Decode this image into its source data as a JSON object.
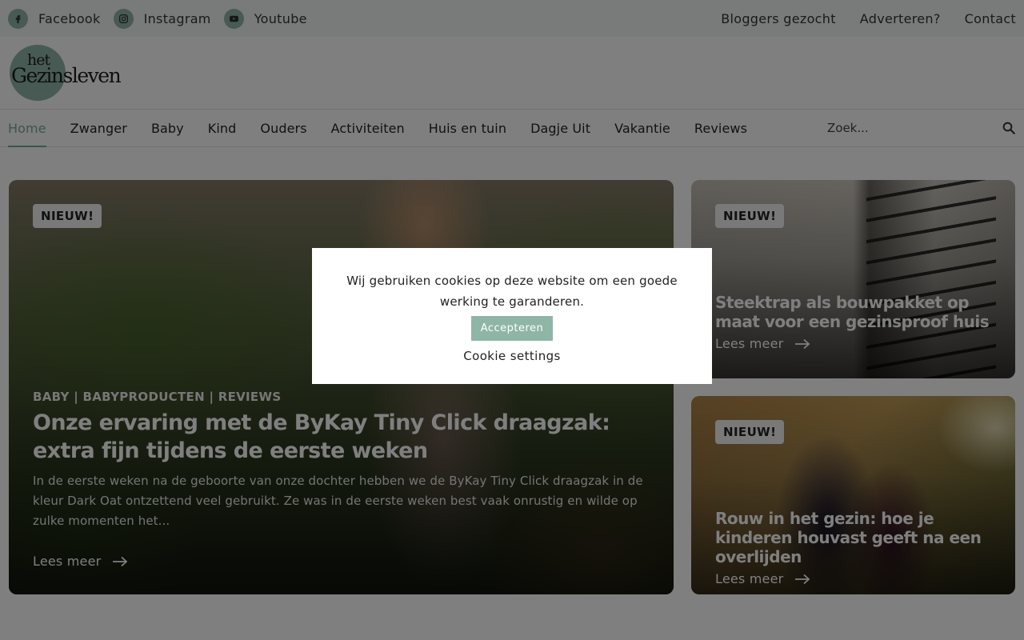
{
  "topbar": {
    "social": [
      {
        "label": "Facebook",
        "icon": "facebook-icon"
      },
      {
        "label": "Instagram",
        "icon": "instagram-icon"
      },
      {
        "label": "Youtube",
        "icon": "youtube-icon"
      }
    ],
    "links": [
      "Bloggers gezocht",
      "Adverteren?",
      "Contact"
    ]
  },
  "logo": {
    "line1": "het",
    "line2": "Gezinsleven"
  },
  "nav": {
    "items": [
      "Home",
      "Zwanger",
      "Baby",
      "Kind",
      "Ouders",
      "Activiteiten",
      "Huis en tuin",
      "Dagje Uit",
      "Vakantie",
      "Reviews"
    ],
    "active_index": 0,
    "search_placeholder": "Zoek..."
  },
  "featured": {
    "badge": "NIEUW!",
    "categories": "BABY | BABYPRODUCTEN | REVIEWS",
    "title": "Onze ervaring met de ByKay Tiny Click draagzak: extra fijn tijdens de eerste weken",
    "excerpt": "In de eerste weken na de geboorte van onze dochter hebben we de ByKay Tiny Click draagzak in de kleur Dark Oat ontzettend veel gebruikt. Ze was in de eerste weken best vaak onrustig en wilde op zulke momenten het...",
    "more": "Lees meer"
  },
  "side_cards": [
    {
      "badge": "NIEUW!",
      "title": "Steektrap als bouwpakket op maat voor een gezinsproof huis",
      "more": "Lees meer"
    },
    {
      "badge": "NIEUW!",
      "title": "Rouw in het gezin: hoe je kinderen houvast geeft na een overlijden",
      "more": "Lees meer"
    }
  ],
  "cookie": {
    "message": "Wij gebruiken cookies op deze website om een goede werking te garanderen.",
    "accept": "Accepteren",
    "settings": "Cookie settings"
  },
  "colors": {
    "accent": "#8fb5a6",
    "nav_active": "#7fa898"
  }
}
